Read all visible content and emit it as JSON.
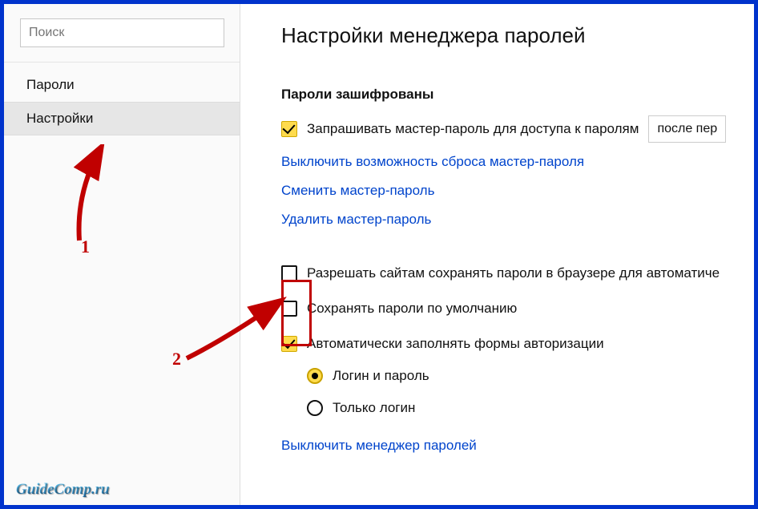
{
  "search": {
    "placeholder": "Поиск"
  },
  "sidebar": {
    "items": [
      {
        "label": "Пароли"
      },
      {
        "label": "Настройки"
      }
    ]
  },
  "main": {
    "title": "Настройки менеджера паролей",
    "section_title": "Пароли зашифрованы",
    "checkboxes": {
      "master_prompt": "Запрашивать мастер-пароль для доступа к паролям",
      "allow_sites": "Разрешать сайтам сохранять пароли в браузере для автоматиче",
      "save_default": "Сохранять пароли по умолчанию",
      "autofill": "Автоматически заполнять формы авторизации"
    },
    "dropdown": {
      "selected": "после пер"
    },
    "links": {
      "disable_reset": "Выключить возможность сброса мастер-пароля",
      "change_master": "Сменить мастер-пароль",
      "delete_master": "Удалить мастер-пароль",
      "disable_manager": "Выключить менеджер паролей"
    },
    "radios": {
      "login_password": "Логин и пароль",
      "login_only": "Только логин"
    }
  },
  "annotations": {
    "marker1": "1",
    "marker2": "2",
    "watermark": "GuideComp.ru"
  }
}
